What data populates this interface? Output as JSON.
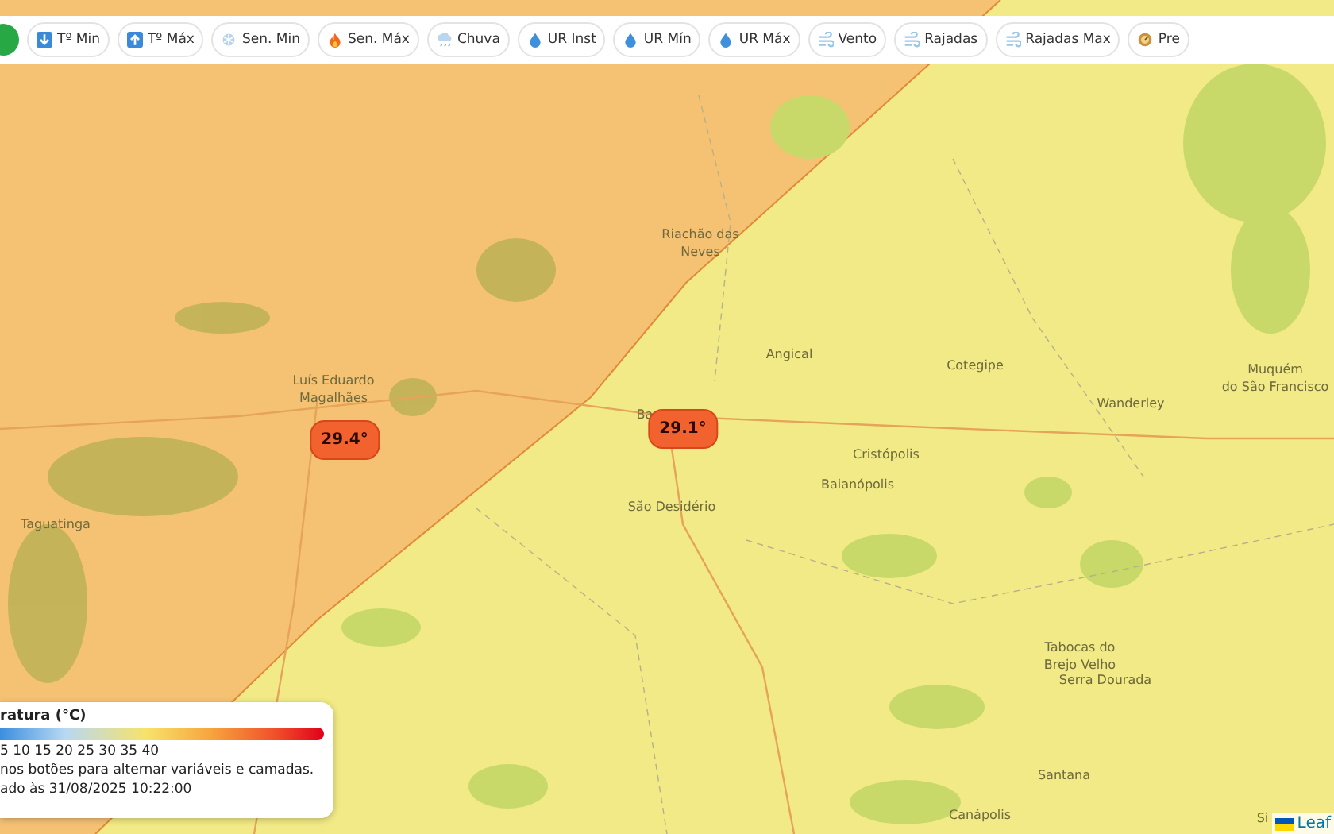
{
  "toolbar": {
    "buttons": [
      {
        "label": "Tº Min",
        "kind": "down",
        "selected": false
      },
      {
        "label": "Tº Máx",
        "kind": "up",
        "selected": false
      },
      {
        "label": "Sen. Min",
        "kind": "cold",
        "selected": false
      },
      {
        "label": "Sen. Máx",
        "kind": "hot",
        "selected": false
      },
      {
        "label": "Chuva",
        "kind": "rain",
        "selected": false
      },
      {
        "label": "UR Inst",
        "kind": "drop",
        "selected": false
      },
      {
        "label": "UR Mín",
        "kind": "drop",
        "selected": false
      },
      {
        "label": "UR Máx",
        "kind": "drop",
        "selected": false
      },
      {
        "label": "Vento",
        "kind": "wind",
        "selected": false
      },
      {
        "label": "Rajadas",
        "kind": "wind",
        "selected": false
      },
      {
        "label": "Rajadas Max",
        "kind": "wind",
        "selected": false
      },
      {
        "label": "Pre",
        "kind": "gauge",
        "selected": false
      }
    ]
  },
  "map": {
    "places": [
      {
        "name": "Riachão das\nNeves"
      },
      {
        "name": "Luís Eduardo\nMagalhães"
      },
      {
        "name": "Angical"
      },
      {
        "name": "Cotegipe"
      },
      {
        "name": "Wanderley"
      },
      {
        "name": "Muquém\ndo São Francisco"
      },
      {
        "name": "Ba"
      },
      {
        "name": "Cristópolis"
      },
      {
        "name": "Baianópolis"
      },
      {
        "name": "São Desidério"
      },
      {
        "name": "Taguatinga"
      },
      {
        "name": "Tabocas do\nBrejo Velho"
      },
      {
        "name": "Serra Dourada"
      },
      {
        "name": "Santana"
      },
      {
        "name": "Canápolis"
      },
      {
        "name": "Si"
      }
    ],
    "markers": [
      {
        "value": "29.4°"
      },
      {
        "value": "29.1°"
      }
    ]
  },
  "legend": {
    "title": "ratura (°C)",
    "scale": "5 10 15 20 25 30 35 40",
    "hint": "nos botões para alternar variáveis e camadas.",
    "updated": "ado às 31/08/2025 10:22:00"
  },
  "attribution": "Leaf"
}
